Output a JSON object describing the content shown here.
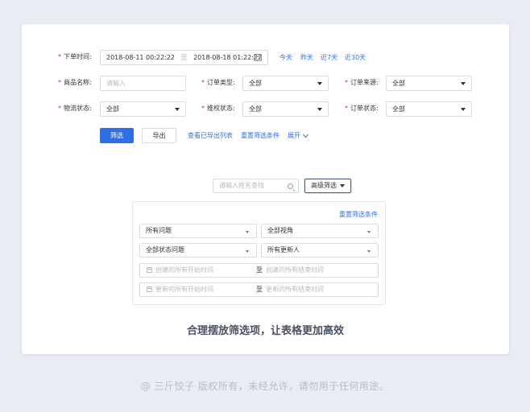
{
  "form": {
    "order_time": {
      "label": "下单时间:",
      "start": "2018-08-11 00:22:22",
      "separator": "至",
      "end": "2018-08-18 01:22:22",
      "quick_links": [
        "今天",
        "昨天",
        "近7天",
        "近30天"
      ]
    },
    "product_name": {
      "label": "商品名称:",
      "placeholder": "请输入"
    },
    "order_type": {
      "label": "订单类型:",
      "value": "全部"
    },
    "order_source": {
      "label": "订单来源:",
      "value": "全部"
    },
    "logistics_status": {
      "label": "物流状态:",
      "value": "全部"
    },
    "rights_status": {
      "label": "维权状态:",
      "value": "全部"
    },
    "order_status": {
      "label": "订单状态:",
      "value": "全部"
    },
    "actions": {
      "filter": "筛选",
      "export": "导出",
      "view_exported": "查看已导出列表",
      "reset": "重置筛选条件",
      "expand": "展开"
    }
  },
  "advanced": {
    "search_placeholder": "请输入姓名查找",
    "advanced_button": "高级筛选",
    "reset_link": "重置筛选条件",
    "selects": [
      "所有问题",
      "全部视角",
      "全部状态问题",
      "所有更新人"
    ],
    "created_start_placeholder": "创建的所有开始时间",
    "created_end_placeholder": "创建的所有结束时间",
    "updated_start_placeholder": "更新的所有开始时间",
    "updated_end_placeholder": "更新的所有结束时间",
    "to": "至"
  },
  "caption": "合理摆放筛选项，让表格更加高效",
  "copyright": "@ 三斤饺子  版权所有，未经允许，请勿用于任何用途。",
  "colors": {
    "primary": "#2f6fe6",
    "required": "#e5302d",
    "background": "#e9ecf3"
  }
}
